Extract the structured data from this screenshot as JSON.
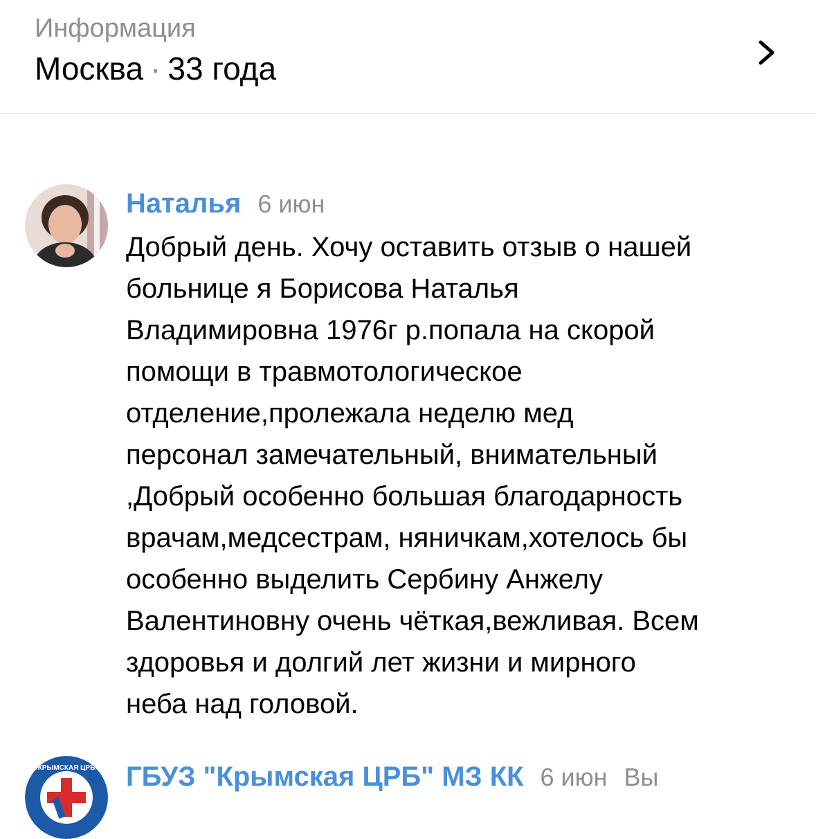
{
  "info": {
    "label": "Информация",
    "city": "Москва",
    "separator": "·",
    "age": "33 года"
  },
  "comments": [
    {
      "author": "Наталья",
      "date": "6 июн",
      "lines": [
        "Добрый день. Хочу оставить отзыв о нашей",
        "больнице я Борисова Наталья",
        "Владимировна 1976г р.попала на скорой",
        "помощи в травмотологическое",
        "отделение,пролежала неделю мед",
        "персонал замечательный, внимательный",
        ",Добрый особенно большая благодарность",
        "врачам,медсестрам, няничкам,хотелось бы",
        "особенно выделить Сербину Анжелу",
        "Валентиновну очень чёткая,вежливая. Всем",
        "здоровья и долгий лет жизни и мирного",
        "неба над головой."
      ]
    },
    {
      "author": "ГБУЗ \"Крымская ЦРБ\" МЗ КК",
      "date": "6 июн",
      "you_label": "Вы",
      "avatar_text": "ГБУЗ «КРЫМСКАЯ ЦРБ» МЗ КК"
    }
  ],
  "colors": {
    "author": "#4a90d9",
    "secondary": "#8e8e93",
    "logo_blue": "#1c5aa8",
    "logo_red": "#d92b2b"
  }
}
